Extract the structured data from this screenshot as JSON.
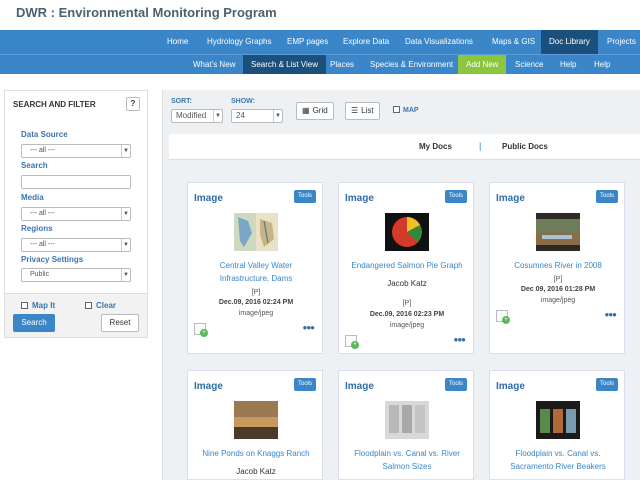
{
  "app": {
    "title": "DWR : Environmental Monitoring Program"
  },
  "nav_primary": [
    "Home",
    "Hydrology Graphs",
    "EMP pages",
    "Explore Data",
    "Data Visualizations",
    "Maps & GIS",
    "Doc Library",
    "Projects"
  ],
  "nav_secondary": [
    "What's New",
    "Search & List View",
    "Places",
    "Species & Environment",
    "Add New",
    "Science",
    "Help",
    "Help"
  ],
  "sidebar": {
    "heading": "SEARCH AND FILTER",
    "help_label": "?",
    "data_source_label": "Data Source",
    "data_source_value": "--- all ---",
    "search_label": "Search",
    "search_value": "",
    "media_label": "Media",
    "media_value": "--- all ---",
    "regions_label": "Regions",
    "regions_value": "--- all ---",
    "privacy_label": "Privacy Settings",
    "privacy_value": "Public",
    "mapit_label": "Map It",
    "clear_label": "Clear",
    "search_button": "Search",
    "reset_button": "Reset"
  },
  "controls": {
    "sort_label": "SORT:",
    "sort_value": "Modified",
    "show_label": "SHOW:",
    "show_value": "24",
    "grid_label": "Grid",
    "list_label": "List",
    "map_label": "MAP"
  },
  "doc_tabs": {
    "my_docs": "My Docs",
    "separator": "|",
    "public_docs": "Public Docs"
  },
  "cards": [
    {
      "type": "Image",
      "tools": "Tools",
      "title_line1": "Central Valley Water",
      "title_line2": "Infrastructure, Dams",
      "author": "",
      "privacy": "[P]",
      "date": "Dec.09, 2016 02:24 PM",
      "mime": "image/jpeg"
    },
    {
      "type": "Image",
      "tools": "Tools",
      "title_line1": "Endangered Salmon Pie Graph",
      "title_line2": "",
      "author": "Jacob Katz",
      "privacy": "[P]",
      "date": "Dec.09, 2016 02:23 PM",
      "mime": "image/jpeg"
    },
    {
      "type": "Image",
      "tools": "Tools",
      "title_line1": "Cosumnes River in 2008",
      "title_line2": "",
      "author": "",
      "privacy": "[P]",
      "date": "Dec 09, 2016 01:28 PM",
      "mime": "image/jpeg"
    },
    {
      "type": "Image",
      "tools": "Tools",
      "title_line1": "Nine Ponds on Knaggs Ranch",
      "title_line2": "",
      "author": "Jacob Katz"
    },
    {
      "type": "Image",
      "tools": "Tools",
      "title_line1": "Floodplain vs. Canal vs. River",
      "title_line2": "Salmon Sizes"
    },
    {
      "type": "Image",
      "tools": "Tools",
      "title_line1": "Floodplain vs. Canal vs.",
      "title_line2": "Sacramento River Beakers"
    }
  ],
  "colors": {
    "nav": "#3a86c8",
    "nav_active": "#1b4f7c",
    "add_new": "#8cc63e",
    "link": "#3a86c8",
    "label": "#3a75b0"
  },
  "icons": {
    "add": "add-to-collection-icon",
    "group": "group-icon",
    "grid": "grid-icon",
    "list": "list-icon"
  }
}
